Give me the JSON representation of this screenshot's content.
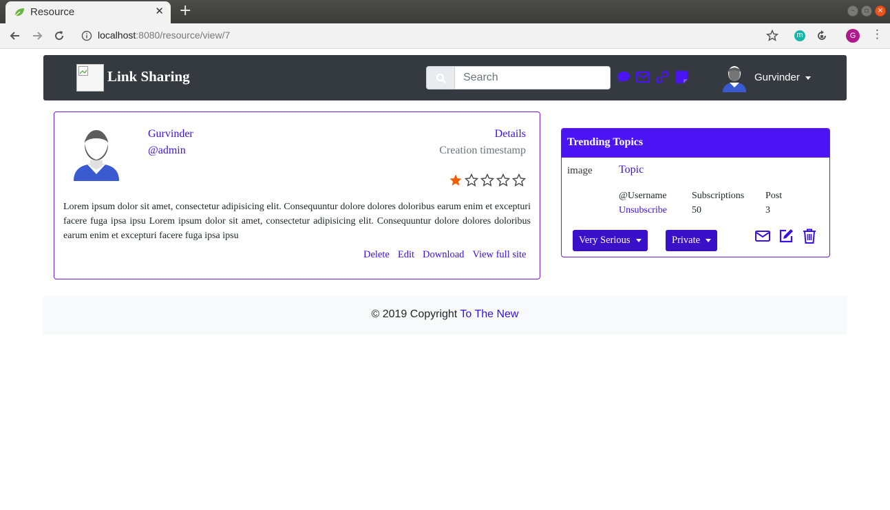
{
  "browser": {
    "tab_title": "Resource",
    "tab_close": "✕",
    "new_tab": "+",
    "url_host": "localhost",
    "url_rest": ":8080/resource/view/7",
    "ext_label": "m",
    "profile_initial": "G"
  },
  "navbar": {
    "brand_title": "Link Sharing",
    "search_placeholder": "Search",
    "user_name": "Gurvinder",
    "icons": [
      "chat-icon",
      "envelope-icon",
      "link-icon",
      "note-icon"
    ]
  },
  "resource": {
    "user_name": "Gurvinder",
    "handle": "@admin",
    "details_link": "Details",
    "timestamp": "Creation timestamp",
    "rating": 1,
    "rating_max": 5,
    "description": "Lorem ipsum dolor sit amet, consectetur adipisicing elit. Consequuntur dolore dolores doloribus earum enim et excepturi facere fuga ipsa ipsu Lorem ipsum dolor sit amet, consectetur adipisicing elit. Consequuntur dolore dolores doloribus earum enim et excepturi facere fuga ipsa ipsu",
    "actions": {
      "delete": "Delete",
      "edit": "Edit",
      "download": "Download",
      "view_full_site": "View full site"
    }
  },
  "trending": {
    "title": "Trending Topics",
    "image_alt": "image",
    "topic_link": "Topic",
    "username": "@Username",
    "unsubscribe": "Unsubscribe",
    "subscriptions_label": "Subscriptions",
    "subscriptions_value": "50",
    "post_label": "Post",
    "post_value": "3",
    "seriousness": "Very Serious",
    "visibility": "Private"
  },
  "footer": {
    "copyright": "© 2019 Copyright",
    "company_link": "To The New"
  },
  "colors": {
    "accent": "#3a10e5",
    "navbar_bg": "#343a40",
    "card_header": "#4a14f5",
    "star_filled": "#f06000"
  }
}
